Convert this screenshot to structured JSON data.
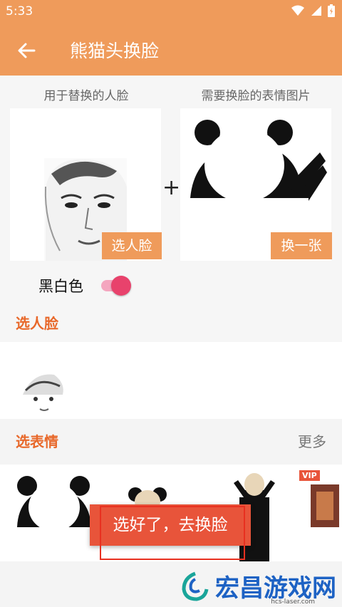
{
  "status": {
    "time": "5:33"
  },
  "appbar": {
    "title": "熊猫头换脸"
  },
  "faces": {
    "left_caption": "用于替换的人脸",
    "right_caption": "需要换脸的表情图片",
    "plus": "+",
    "pick_face_label": "选人脸",
    "change_label": "换一张"
  },
  "toggle": {
    "label": "黑白色",
    "on": true
  },
  "sections": {
    "pick_face": "选人脸",
    "pick_sticker": "选表情",
    "more": "更多"
  },
  "toast": {
    "text": "选好了，去换脸"
  },
  "watermark": {
    "text": "宏昌游戏网",
    "sub": "hcs-laser.com"
  },
  "sticker_strip": {
    "vip": "VIP"
  },
  "colors": {
    "accent": "#ef9b5b",
    "section": "#e8682a",
    "toggle": "#e8426c",
    "toast": "#e8543a"
  }
}
